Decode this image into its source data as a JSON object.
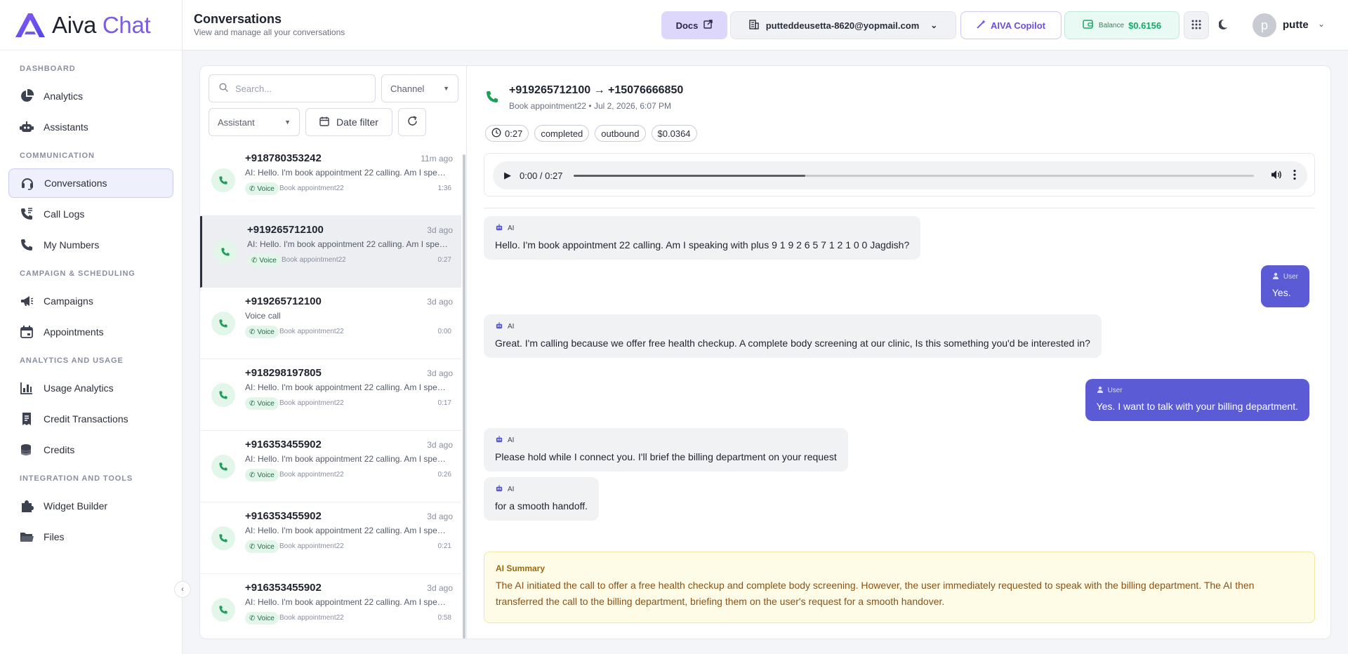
{
  "brand": {
    "name_a": "Aiva",
    "name_b": "Chat"
  },
  "sidebar": {
    "sections": [
      {
        "title": "DASHBOARD",
        "items": [
          {
            "label": "Analytics",
            "icon": "pie-chart-icon"
          },
          {
            "label": "Assistants",
            "icon": "robot-icon"
          }
        ]
      },
      {
        "title": "COMMUNICATION",
        "items": [
          {
            "label": "Conversations",
            "icon": "headset-icon",
            "active": true
          },
          {
            "label": "Call Logs",
            "icon": "phone-log-icon"
          },
          {
            "label": "My Numbers",
            "icon": "phone-icon"
          }
        ]
      },
      {
        "title": "CAMPAIGN & SCHEDULING",
        "items": [
          {
            "label": "Campaigns",
            "icon": "megaphone-icon"
          },
          {
            "label": "Appointments",
            "icon": "calendar-icon"
          }
        ]
      },
      {
        "title": "ANALYTICS AND USAGE",
        "items": [
          {
            "label": "Usage Analytics",
            "icon": "bar-chart-icon"
          },
          {
            "label": "Credit Transactions",
            "icon": "receipt-icon"
          },
          {
            "label": "Credits",
            "icon": "coins-icon"
          }
        ]
      },
      {
        "title": "INTEGRATION AND TOOLS",
        "items": [
          {
            "label": "Widget Builder",
            "icon": "puzzle-icon"
          },
          {
            "label": "Files",
            "icon": "folder-icon"
          }
        ]
      }
    ]
  },
  "header": {
    "title": "Conversations",
    "subtitle": "View and manage all your conversations",
    "docs_label": "Docs",
    "email": "putteddeusetta-8620@yopmail.com",
    "copilot_label": "AIVA Copilot",
    "balance_label": "Balance",
    "balance_value": "$0.6156",
    "avatar_letter": "p",
    "username": "putte"
  },
  "filters": {
    "search_placeholder": "Search...",
    "channel": "Channel",
    "assistant": "Assistant",
    "date_filter": "Date filter"
  },
  "conversations": [
    {
      "number": "+918780353242",
      "ago": "11m ago",
      "preview": "AI: Hello. I'm book appointment 22 calling. Am I speaking with plus",
      "channel": "Voice",
      "assistant": "Book appointment22",
      "duration": "1:36"
    },
    {
      "number": "+919265712100",
      "ago": "3d ago",
      "preview": "AI: Hello. I'm book appointment 22 calling. Am I speaking with plus",
      "channel": "Voice",
      "assistant": "Book appointment22",
      "duration": "0:27",
      "active": true
    },
    {
      "number": "+919265712100",
      "ago": "3d ago",
      "preview": "Voice call",
      "channel": "Voice",
      "assistant": "Book appointment22",
      "duration": "0:00"
    },
    {
      "number": "+918298197805",
      "ago": "3d ago",
      "preview": "AI: Hello. I'm book appointment 22 calling. Am I speaking with plus",
      "channel": "Voice",
      "assistant": "Book appointment22",
      "duration": "0:17"
    },
    {
      "number": "+916353455902",
      "ago": "3d ago",
      "preview": "AI: Hello. I'm book appointment 22 calling. Am I speaking with plus",
      "channel": "Voice",
      "assistant": "Book appointment22",
      "duration": "0:26"
    },
    {
      "number": "+916353455902",
      "ago": "3d ago",
      "preview": "AI: Hello. I'm book appointment 22 calling. Am I speaking with plus",
      "channel": "Voice",
      "assistant": "Book appointment22",
      "duration": "0:21"
    },
    {
      "number": "+916353455902",
      "ago": "3d ago",
      "preview": "AI: Hello. I'm book appointment 22 calling. Am I speaking with plus",
      "channel": "Voice",
      "assistant": "Book appointment22",
      "duration": "0:58"
    }
  ],
  "detail": {
    "title": "+919265712100 → +15076666850",
    "subtitle": "Book appointment22 • Jul 2, 2026, 6:07 PM",
    "tags": {
      "duration": "0:27",
      "status": "completed",
      "direction": "outbound",
      "cost": "$0.0364"
    },
    "audio": {
      "time": "0:00 / 0:27",
      "buffered_fraction": 0.34
    },
    "messages": [
      {
        "role": "AI",
        "text": "Hello. I'm book appointment 22 calling. Am I speaking with plus 9 1 9 2 6 5 7 1 2 1 0 0 Jagdish?"
      },
      {
        "role": "User",
        "text": "Yes."
      },
      {
        "role": "AI",
        "text": "Great. I'm calling because we offer free health checkup. A complete body screening at our clinic, Is this something you'd be interested in?"
      },
      {
        "role": "User",
        "text": "Yes. I want to talk with your billing department."
      },
      {
        "role": "AI",
        "text": "Please hold while I connect you. I'll brief the billing department on your request"
      },
      {
        "role": "AI",
        "text": "for a smooth handoff."
      }
    ],
    "summary_title": "AI Summary",
    "summary_text": "The AI initiated the call to offer a free health checkup and complete body screening. However, the user immediately requested to speak with the billing department. The AI then transferred the call to the billing department, briefing them on the user's request for a smooth handover."
  },
  "colors": {
    "accent": "#5b5bd6",
    "brand": "#7c5ce0",
    "success": "#17a76a",
    "summary_bg": "#fefbe6"
  }
}
